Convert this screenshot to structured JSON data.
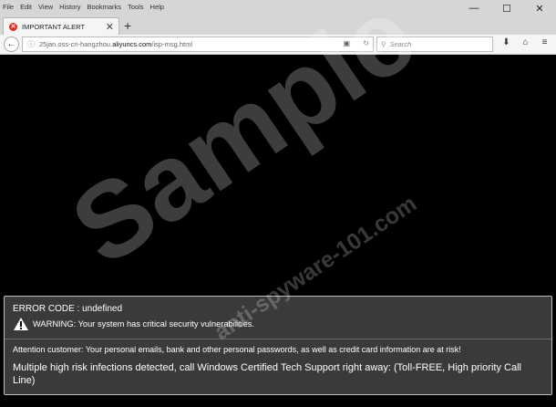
{
  "menu": [
    "File",
    "Edit",
    "View",
    "History",
    "Bookmarks",
    "Tools",
    "Help"
  ],
  "window_controls": {
    "minimize": "—",
    "maximize": "☐",
    "close": "✕"
  },
  "tab": {
    "title": "IMPORTANT ALERT",
    "close": "✕",
    "new_tab": "+"
  },
  "nav": {
    "back": "←",
    "url_info_icon": "ⓘ",
    "url_prefix": "25jan.oss-cn-hangzhou.",
    "url_domain": "aliyuncs.com",
    "url_path": "/isp-msg.html",
    "search_placeholder": "Search",
    "icons": [
      "reader-icon",
      "reload-icon",
      "download-icon",
      "home-icon",
      "menu-icon"
    ]
  },
  "alert": {
    "error_code": "ERROR CODE : undefined",
    "warning": "WARNING: Your system has critical security vulnerabilities.",
    "attention": "Attention customer: Your personal emails, bank and other personal passwords, as well as credit card information are at risk!",
    "infection": "Multiple high risk infections detected, call Windows Certified Tech Support right away: (Toll-FREE, High priority Call Line)"
  },
  "watermark": {
    "main": "Sample",
    "site": "anti-spyware-101.com"
  }
}
